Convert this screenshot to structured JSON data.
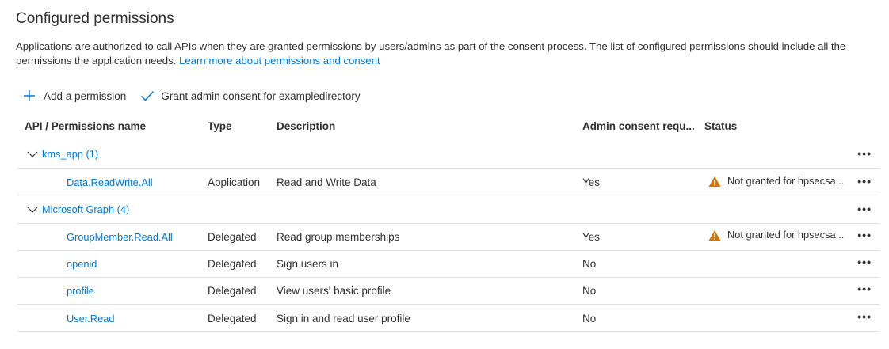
{
  "section": {
    "title": "Configured permissions",
    "description": "Applications are authorized to call APIs when they are granted permissions by users/admins as part of the consent process. The list of configured permissions should include all the permissions the application needs.",
    "learn_more": "Learn more about permissions and consent"
  },
  "toolbar": {
    "add_label": "Add a permission",
    "grant_label": "Grant admin consent for exampledirectory"
  },
  "table": {
    "headers": {
      "name": "API / Permissions name",
      "type": "Type",
      "description": "Description",
      "admin": "Admin consent requ...",
      "status": "Status"
    },
    "groups": [
      {
        "label": "kms_app (1)",
        "rows": [
          {
            "name": "Data.ReadWrite.All",
            "type": "Application",
            "description": "Read and Write Data",
            "admin": "Yes",
            "status": "Not granted for hpsecsa..."
          }
        ]
      },
      {
        "label": "Microsoft Graph (4)",
        "rows": [
          {
            "name": "GroupMember.Read.All",
            "type": "Delegated",
            "description": "Read group memberships",
            "admin": "Yes",
            "status": "Not granted for hpsecsa..."
          },
          {
            "name": "openid",
            "type": "Delegated",
            "description": "Sign users in",
            "admin": "No",
            "status": ""
          },
          {
            "name": "profile",
            "type": "Delegated",
            "description": "View users' basic profile",
            "admin": "No",
            "status": ""
          },
          {
            "name": "User.Read",
            "type": "Delegated",
            "description": "Sign in and read user profile",
            "admin": "No",
            "status": ""
          }
        ]
      }
    ],
    "more_label": "•••"
  },
  "colors": {
    "link": "#0078d4",
    "text": "#323130",
    "warning": "#d47500",
    "divider": "#e1dfdd"
  }
}
